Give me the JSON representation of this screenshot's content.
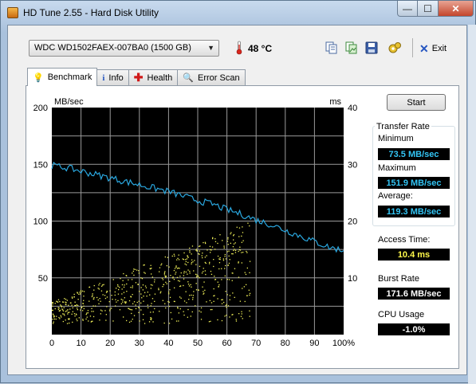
{
  "window": {
    "title": "HD Tune 2.55 - Hard Disk Utility",
    "min_label": "—",
    "max_label": "☐",
    "close_label": "✕"
  },
  "toolbar": {
    "drive": "WDC WD1502FAEX-007BA0 (1500 GB)",
    "temperature": "48 °C",
    "exit_label": "Exit",
    "icons": [
      "copy-text-icon",
      "copy-picture-icon",
      "save-icon",
      "options-icon"
    ]
  },
  "tabs": [
    {
      "label": "Benchmark",
      "icon": "benchmark-icon",
      "active": true
    },
    {
      "label": "Info",
      "icon": "info-icon",
      "active": false
    },
    {
      "label": "Health",
      "icon": "health-icon",
      "active": false
    },
    {
      "label": "Error Scan",
      "icon": "magnifier-icon",
      "active": false
    }
  ],
  "benchmark": {
    "start_label": "Start",
    "transfer_rate_title": "Transfer Rate",
    "minimum_label": "Minimum",
    "minimum_value": "73.5 MB/sec",
    "maximum_label": "Maximum",
    "maximum_value": "151.9 MB/sec",
    "average_label": "Average:",
    "average_value": "119.3 MB/sec",
    "access_time_label": "Access Time:",
    "access_time_value": "10.4 ms",
    "burst_rate_label": "Burst Rate",
    "burst_rate_value": "171.6 MB/sec",
    "cpu_usage_label": "CPU Usage",
    "cpu_usage_value": "-1.0%"
  },
  "colors": {
    "transfer_line": "#2aa7df",
    "access_points": "#f2f25a",
    "grid": "#9a9a9a",
    "plot_bg": "#000000",
    "value_blue": "#33c5f5",
    "value_yellow": "#fff94a"
  },
  "chart_data": {
    "type": "line",
    "left_axis_label": "MB/sec",
    "right_axis_label": "ms",
    "left_ticks": [
      "200",
      "150",
      "100",
      "50"
    ],
    "right_ticks": [
      "40",
      "30",
      "20",
      "10"
    ],
    "x_ticks": [
      "0",
      "10",
      "20",
      "30",
      "40",
      "50",
      "60",
      "70",
      "80",
      "90",
      "100%"
    ],
    "ylim_left": [
      0,
      200
    ],
    "ylim_right": [
      0,
      40
    ],
    "xlim": [
      0,
      100
    ],
    "grid": true,
    "series": [
      {
        "axis": "left",
        "x": [
          0,
          5,
          10,
          15,
          20,
          25,
          30,
          35,
          40,
          45,
          50,
          55,
          60,
          65,
          70,
          75,
          80,
          85,
          90,
          95,
          100
        ],
        "values": [
          149,
          147,
          144,
          141,
          138,
          135,
          132,
          129,
          126,
          122,
          118,
          115,
          110,
          106,
          101,
          97,
          92,
          87,
          82,
          77,
          74
        ]
      },
      {
        "axis": "right",
        "kind": "scatter",
        "x_range": [
          0,
          68
        ],
        "y_range_ms": [
          2,
          20
        ],
        "typical_ms": 10.4
      }
    ]
  }
}
